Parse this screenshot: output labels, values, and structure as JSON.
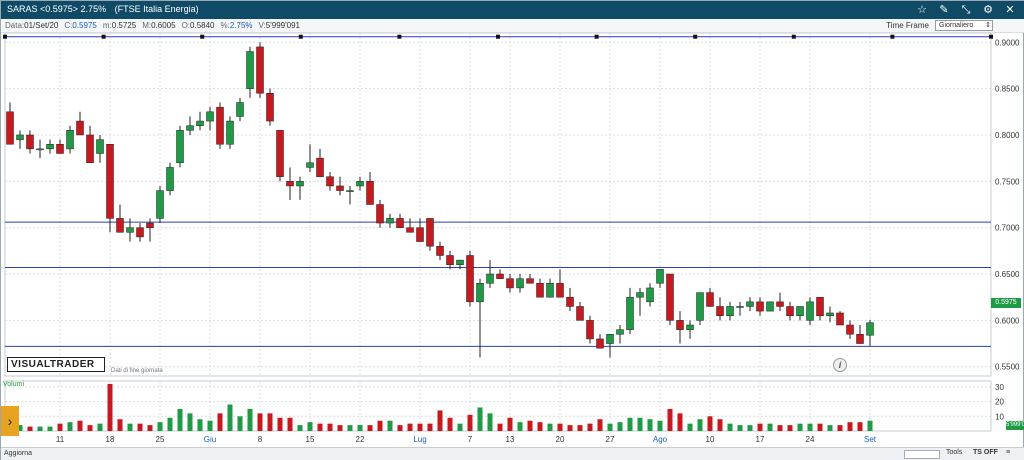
{
  "title": {
    "symbol": "SARAS <0.5975> 2.75%",
    "index": "(FTSE Italia Energia)"
  },
  "toolbar_icons": [
    "star-icon",
    "pen-icon",
    "expand-icon",
    "gear-icon",
    "close-icon"
  ],
  "infobar": {
    "data_label": "Data:",
    "data_val": "01/Set/20",
    "close_label": "C:",
    "close_val": "0.5975",
    "min_label": "m:",
    "min_val": "0.5725",
    "max_label": "M:",
    "max_val": "0.6005",
    "open_label": "O:",
    "open_val": "0.5840",
    "pct_label": "%:",
    "pct_val": "2.75%",
    "vol_label": "V:",
    "vol_val": "5'999'091",
    "timeframe_label": "Time Frame",
    "timeframe_value": "Giornaliero"
  },
  "logo": "VISUALTRADER",
  "logo_sub": "Dati di fine giornata",
  "info_icon": "i",
  "volume_label": "Volumi",
  "last_price": "0.5975",
  "last_volume": "5'999'091",
  "bottombar": {
    "aggiorna": "Aggiorna",
    "tools": "Tools",
    "tsoff": "TS OFF",
    "eq": "≡"
  },
  "colors": {
    "up": "#1f9a45",
    "down": "#c8191f",
    "hline": "#2c3fb5",
    "grid": "#d8dde3"
  },
  "chart_data": {
    "type": "candlestick",
    "ylim": [
      0.54,
      0.91
    ],
    "yticks": [
      "0.5500",
      "0.6000",
      "0.6500",
      "0.7000",
      "0.7500",
      "0.8000",
      "0.8500",
      "0.9000"
    ],
    "xticks": [
      "11",
      "18",
      "25",
      "Giu",
      "8",
      "15",
      "22",
      "Lug",
      "7",
      "13",
      "20",
      "27",
      "Ago",
      "10",
      "17",
      "24",
      "Set"
    ],
    "xticks_at": [
      5,
      10,
      15,
      20,
      25,
      30,
      35,
      41,
      46,
      50,
      55,
      60,
      65,
      70,
      75,
      80,
      86
    ],
    "hlines": [
      0.906,
      0.706,
      0.657,
      0.572
    ],
    "volume_ticks": [
      10,
      20,
      30
    ],
    "volume_ylim": [
      0,
      34
    ],
    "candles": [
      [
        0.825,
        0.835,
        0.79,
        0.79
      ],
      [
        0.795,
        0.805,
        0.785,
        0.8
      ],
      [
        0.8,
        0.805,
        0.78,
        0.785
      ],
      [
        0.785,
        0.795,
        0.775,
        0.785
      ],
      [
        0.785,
        0.795,
        0.78,
        0.79
      ],
      [
        0.79,
        0.795,
        0.78,
        0.78
      ],
      [
        0.785,
        0.81,
        0.78,
        0.805
      ],
      [
        0.815,
        0.825,
        0.8,
        0.8
      ],
      [
        0.8,
        0.81,
        0.77,
        0.77
      ],
      [
        0.78,
        0.8,
        0.77,
        0.795
      ],
      [
        0.79,
        0.79,
        0.695,
        0.71
      ],
      [
        0.71,
        0.725,
        0.695,
        0.695
      ],
      [
        0.695,
        0.71,
        0.685,
        0.7
      ],
      [
        0.7,
        0.705,
        0.685,
        0.69
      ],
      [
        0.705,
        0.71,
        0.685,
        0.7
      ],
      [
        0.71,
        0.745,
        0.705,
        0.74
      ],
      [
        0.74,
        0.77,
        0.735,
        0.765
      ],
      [
        0.77,
        0.81,
        0.765,
        0.805
      ],
      [
        0.805,
        0.82,
        0.8,
        0.81
      ],
      [
        0.81,
        0.825,
        0.805,
        0.815
      ],
      [
        0.815,
        0.83,
        0.805,
        0.825
      ],
      [
        0.83,
        0.835,
        0.785,
        0.79
      ],
      [
        0.79,
        0.82,
        0.785,
        0.815
      ],
      [
        0.82,
        0.84,
        0.815,
        0.835
      ],
      [
        0.85,
        0.895,
        0.84,
        0.89
      ],
      [
        0.895,
        0.9,
        0.84,
        0.845
      ],
      [
        0.845,
        0.85,
        0.81,
        0.815
      ],
      [
        0.805,
        0.805,
        0.75,
        0.755
      ],
      [
        0.75,
        0.765,
        0.73,
        0.745
      ],
      [
        0.745,
        0.755,
        0.73,
        0.75
      ],
      [
        0.765,
        0.79,
        0.76,
        0.77
      ],
      [
        0.775,
        0.785,
        0.755,
        0.755
      ],
      [
        0.755,
        0.76,
        0.74,
        0.745
      ],
      [
        0.745,
        0.755,
        0.735,
        0.74
      ],
      [
        0.74,
        0.745,
        0.725,
        0.74
      ],
      [
        0.745,
        0.755,
        0.74,
        0.75
      ],
      [
        0.75,
        0.76,
        0.725,
        0.725
      ],
      [
        0.725,
        0.73,
        0.7,
        0.705
      ],
      [
        0.705,
        0.715,
        0.7,
        0.71
      ],
      [
        0.71,
        0.715,
        0.7,
        0.7
      ],
      [
        0.7,
        0.71,
        0.695,
        0.695
      ],
      [
        0.7,
        0.71,
        0.685,
        0.685
      ],
      [
        0.71,
        0.71,
        0.675,
        0.68
      ],
      [
        0.68,
        0.685,
        0.665,
        0.67
      ],
      [
        0.67,
        0.675,
        0.655,
        0.66
      ],
      [
        0.66,
        0.665,
        0.655,
        0.665
      ],
      [
        0.67,
        0.675,
        0.615,
        0.62
      ],
      [
        0.62,
        0.645,
        0.56,
        0.64
      ],
      [
        0.64,
        0.665,
        0.635,
        0.65
      ],
      [
        0.65,
        0.655,
        0.645,
        0.645
      ],
      [
        0.645,
        0.65,
        0.63,
        0.635
      ],
      [
        0.635,
        0.65,
        0.63,
        0.645
      ],
      [
        0.645,
        0.65,
        0.64,
        0.64
      ],
      [
        0.64,
        0.645,
        0.625,
        0.625
      ],
      [
        0.625,
        0.645,
        0.625,
        0.64
      ],
      [
        0.64,
        0.655,
        0.625,
        0.625
      ],
      [
        0.625,
        0.635,
        0.61,
        0.615
      ],
      [
        0.615,
        0.62,
        0.6,
        0.6
      ],
      [
        0.6,
        0.605,
        0.575,
        0.58
      ],
      [
        0.58,
        0.585,
        0.57,
        0.57
      ],
      [
        0.575,
        0.585,
        0.56,
        0.585
      ],
      [
        0.585,
        0.595,
        0.575,
        0.59
      ],
      [
        0.59,
        0.635,
        0.585,
        0.625
      ],
      [
        0.625,
        0.635,
        0.605,
        0.63
      ],
      [
        0.62,
        0.64,
        0.615,
        0.635
      ],
      [
        0.64,
        0.655,
        0.635,
        0.655
      ],
      [
        0.65,
        0.65,
        0.595,
        0.6
      ],
      [
        0.6,
        0.61,
        0.575,
        0.59
      ],
      [
        0.59,
        0.6,
        0.58,
        0.595
      ],
      [
        0.6,
        0.63,
        0.595,
        0.63
      ],
      [
        0.63,
        0.635,
        0.615,
        0.615
      ],
      [
        0.615,
        0.625,
        0.6,
        0.605
      ],
      [
        0.605,
        0.62,
        0.6,
        0.615
      ],
      [
        0.615,
        0.62,
        0.605,
        0.615
      ],
      [
        0.615,
        0.625,
        0.61,
        0.62
      ],
      [
        0.62,
        0.625,
        0.605,
        0.61
      ],
      [
        0.61,
        0.62,
        0.61,
        0.62
      ],
      [
        0.62,
        0.63,
        0.61,
        0.615
      ],
      [
        0.615,
        0.62,
        0.6,
        0.605
      ],
      [
        0.605,
        0.615,
        0.6,
        0.615
      ],
      [
        0.6,
        0.625,
        0.595,
        0.62
      ],
      [
        0.625,
        0.625,
        0.6,
        0.605
      ],
      [
        0.605,
        0.615,
        0.598,
        0.608
      ],
      [
        0.608,
        0.61,
        0.595,
        0.595
      ],
      [
        0.595,
        0.6,
        0.58,
        0.585
      ],
      [
        0.585,
        0.595,
        0.575,
        0.575
      ],
      [
        0.584,
        0.6005,
        0.5725,
        0.5975
      ]
    ],
    "volumes": [
      9,
      4,
      3,
      3,
      3,
      5,
      6,
      7,
      4,
      5,
      32,
      8,
      5,
      5,
      4,
      6,
      9,
      15,
      12,
      8,
      7,
      12,
      18,
      10,
      15,
      12,
      12,
      9,
      9,
      4,
      6,
      5,
      5,
      4,
      4,
      4,
      4,
      7,
      7,
      4,
      5,
      5,
      5,
      14,
      9,
      5,
      11,
      16,
      12,
      5,
      9,
      6,
      7,
      6,
      5,
      5,
      4,
      4,
      5,
      8,
      5,
      6,
      9,
      9,
      8,
      7,
      15,
      12,
      5,
      8,
      10,
      8,
      5,
      4,
      4,
      5,
      5,
      4,
      4,
      5,
      5,
      5,
      4,
      4,
      6,
      6,
      7
    ]
  }
}
